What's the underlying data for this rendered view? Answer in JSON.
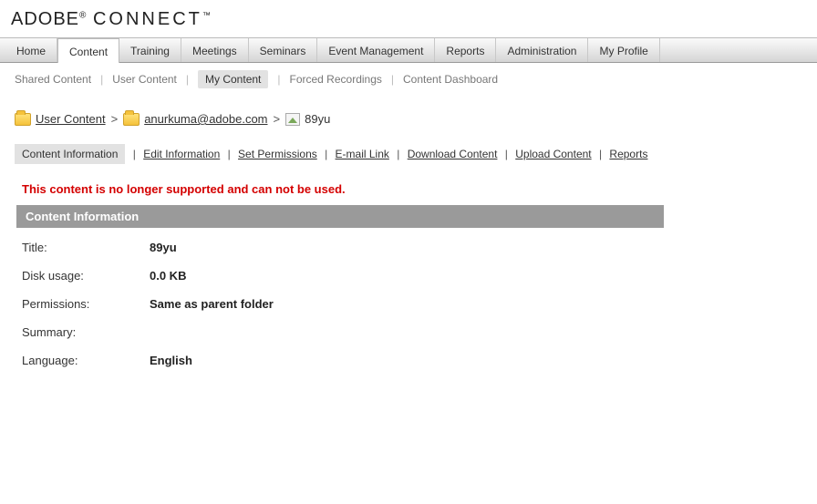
{
  "brand": {
    "name": "ADOBE",
    "product": "CONNECT"
  },
  "mainNav": {
    "items": [
      "Home",
      "Content",
      "Training",
      "Meetings",
      "Seminars",
      "Event Management",
      "Reports",
      "Administration",
      "My Profile"
    ],
    "activeIndex": 1
  },
  "subNav": {
    "items": [
      "Shared Content",
      "User Content",
      "My Content",
      "Forced Recordings",
      "Content Dashboard"
    ],
    "activeIndex": 2
  },
  "breadcrumb": {
    "items": [
      {
        "label": "User Content",
        "type": "folder"
      },
      {
        "label": "anurkuma@adobe.com",
        "type": "folder"
      },
      {
        "label": "89yu",
        "type": "file"
      }
    ],
    "separator": ">"
  },
  "actions": {
    "items": [
      "Content Information",
      "Edit Information",
      "Set Permissions",
      "E-mail Link",
      "Download Content",
      "Upload Content",
      "Reports"
    ],
    "activeIndex": 0,
    "separator": "|"
  },
  "warningMessage": "This content is no longer supported and can not be used.",
  "section": {
    "title": "Content Information",
    "rows": [
      {
        "label": "Title:",
        "value": "89yu"
      },
      {
        "label": "Disk usage:",
        "value": "0.0 KB"
      },
      {
        "label": "Permissions:",
        "value": "Same as parent folder"
      },
      {
        "label": "Summary:",
        "value": ""
      },
      {
        "label": "Language:",
        "value": "English"
      }
    ]
  }
}
